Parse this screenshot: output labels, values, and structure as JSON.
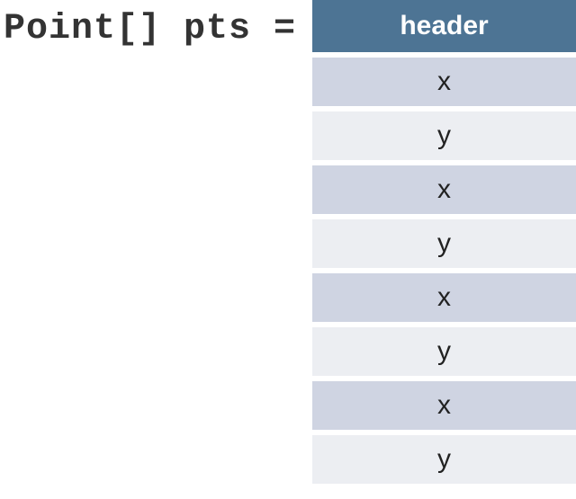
{
  "code": {
    "declaration": "Point[] pts ="
  },
  "table": {
    "header": "header",
    "rows": [
      {
        "label": "x",
        "shade": "x"
      },
      {
        "label": "y",
        "shade": "y"
      },
      {
        "label": "x",
        "shade": "x"
      },
      {
        "label": "y",
        "shade": "y"
      },
      {
        "label": "x",
        "shade": "x"
      },
      {
        "label": "y",
        "shade": "y"
      },
      {
        "label": "x",
        "shade": "x"
      },
      {
        "label": "y",
        "shade": "y"
      }
    ]
  }
}
